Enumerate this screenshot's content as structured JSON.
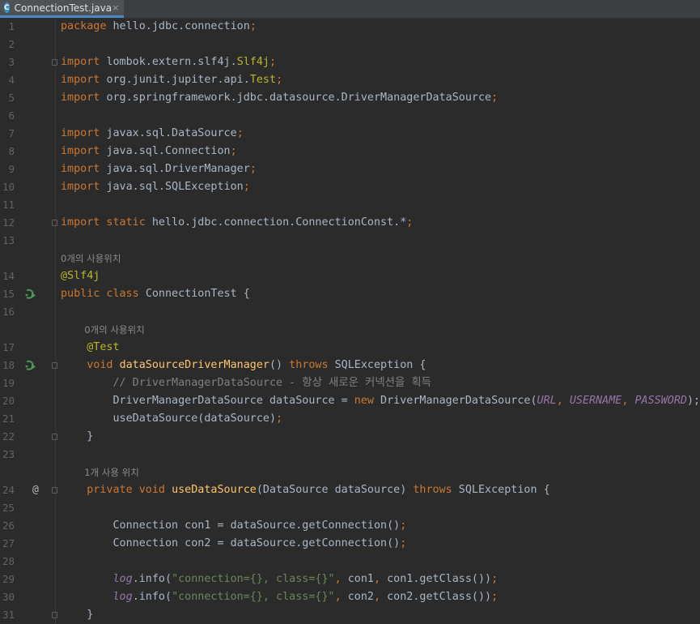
{
  "tab": {
    "filename": "ConnectionTest.java",
    "close": "×",
    "icon_letter": "C"
  },
  "gutter": {
    "run_icon": "run-test-icon",
    "implements_icon": "@"
  },
  "hints": {
    "class_usage": "0개의 사용위치",
    "test_usage": "0개의 사용위치",
    "method_usage": "1개 사용 위치"
  },
  "lines": [
    {
      "n": "1",
      "segs": [
        {
          "t": "package ",
          "c": "kw"
        },
        {
          "t": "hello.jdbc.connection"
        },
        {
          "t": ";",
          "c": "kw"
        }
      ]
    },
    {
      "n": "2",
      "segs": []
    },
    {
      "n": "3",
      "fold": true,
      "segs": [
        {
          "t": "import ",
          "c": "kw"
        },
        {
          "t": "lombok.extern.slf4j."
        },
        {
          "t": "Slf4j",
          "c": "ann"
        },
        {
          "t": ";",
          "c": "kw"
        }
      ]
    },
    {
      "n": "4",
      "segs": [
        {
          "t": "import ",
          "c": "kw"
        },
        {
          "t": "org.junit.jupiter.api."
        },
        {
          "t": "Test",
          "c": "ann"
        },
        {
          "t": ";",
          "c": "kw"
        }
      ]
    },
    {
      "n": "5",
      "segs": [
        {
          "t": "import ",
          "c": "kw"
        },
        {
          "t": "org.springframework.jdbc.datasource.DriverManagerDataSource"
        },
        {
          "t": ";",
          "c": "kw"
        }
      ]
    },
    {
      "n": "6",
      "segs": []
    },
    {
      "n": "7",
      "segs": [
        {
          "t": "import ",
          "c": "kw"
        },
        {
          "t": "javax.sql.DataSource"
        },
        {
          "t": ";",
          "c": "kw"
        }
      ]
    },
    {
      "n": "8",
      "segs": [
        {
          "t": "import ",
          "c": "kw"
        },
        {
          "t": "java.sql.Connection"
        },
        {
          "t": ";",
          "c": "kw"
        }
      ]
    },
    {
      "n": "9",
      "segs": [
        {
          "t": "import ",
          "c": "kw"
        },
        {
          "t": "java.sql.DriverManager"
        },
        {
          "t": ";",
          "c": "kw"
        }
      ]
    },
    {
      "n": "10",
      "segs": [
        {
          "t": "import ",
          "c": "kw"
        },
        {
          "t": "java.sql.SQLException"
        },
        {
          "t": ";",
          "c": "kw"
        }
      ]
    },
    {
      "n": "11",
      "segs": []
    },
    {
      "n": "12",
      "fold": true,
      "segs": [
        {
          "t": "import static ",
          "c": "kw"
        },
        {
          "t": "hello.jdbc.connection.ConnectionConst.*"
        },
        {
          "t": ";",
          "c": "kw"
        }
      ]
    },
    {
      "n": "13",
      "segs": []
    },
    {
      "hint": "class_usage",
      "indent": 0
    },
    {
      "n": "14",
      "segs": [
        {
          "t": "@Slf4j",
          "c": "ann"
        }
      ]
    },
    {
      "n": "15",
      "run": true,
      "segs": [
        {
          "t": "public class ",
          "c": "kw"
        },
        {
          "t": "ConnectionTest {"
        }
      ]
    },
    {
      "n": "16",
      "segs": []
    },
    {
      "hint": "test_usage",
      "indent": 4
    },
    {
      "n": "17",
      "segs": [
        {
          "t": "    "
        },
        {
          "t": "@Test",
          "c": "ann"
        }
      ]
    },
    {
      "n": "18",
      "run": true,
      "fold": true,
      "segs": [
        {
          "t": "    "
        },
        {
          "t": "void ",
          "c": "kw"
        },
        {
          "t": "dataSourceDriverManager",
          "c": "fn"
        },
        {
          "t": "() "
        },
        {
          "t": "throws ",
          "c": "kw"
        },
        {
          "t": "SQLException {"
        }
      ]
    },
    {
      "n": "19",
      "segs": [
        {
          "t": "        "
        },
        {
          "t": "// DriverManagerDataSource - 항상 새로운 커넥션을 획득",
          "c": "cmt"
        }
      ]
    },
    {
      "n": "20",
      "segs": [
        {
          "t": "        DriverManagerDataSource dataSource = "
        },
        {
          "t": "new ",
          "c": "kw"
        },
        {
          "t": "DriverManagerDataSource("
        },
        {
          "t": "URL",
          "c": "cst"
        },
        {
          "t": ", ",
          "c": "kw"
        },
        {
          "t": "USERNAME",
          "c": "cst"
        },
        {
          "t": ", ",
          "c": "kw"
        },
        {
          "t": "PASSWORD",
          "c": "cst"
        },
        {
          "t": ");"
        }
      ]
    },
    {
      "n": "21",
      "segs": [
        {
          "t": "        useDataSource(dataSource)"
        },
        {
          "t": ";",
          "c": "kw"
        }
      ]
    },
    {
      "n": "22",
      "fold": true,
      "segs": [
        {
          "t": "    }"
        }
      ]
    },
    {
      "n": "23",
      "segs": []
    },
    {
      "hint": "method_usage",
      "indent": 4
    },
    {
      "n": "24",
      "impl": true,
      "fold": true,
      "segs": [
        {
          "t": "    "
        },
        {
          "t": "private void ",
          "c": "kw"
        },
        {
          "t": "useDataSource",
          "c": "fn"
        },
        {
          "t": "(DataSource dataSource) "
        },
        {
          "t": "throws ",
          "c": "kw"
        },
        {
          "t": "SQLException {"
        }
      ]
    },
    {
      "n": "25",
      "segs": []
    },
    {
      "n": "26",
      "segs": [
        {
          "t": "        Connection con1 = dataSource.getConnection()"
        },
        {
          "t": ";",
          "c": "kw"
        }
      ]
    },
    {
      "n": "27",
      "segs": [
        {
          "t": "        Connection con2 = dataSource.getConnection()"
        },
        {
          "t": ";",
          "c": "kw"
        }
      ]
    },
    {
      "n": "28",
      "segs": []
    },
    {
      "n": "29",
      "segs": [
        {
          "t": "        "
        },
        {
          "t": "log",
          "c": "fld"
        },
        {
          "t": ".info("
        },
        {
          "t": "\"connection={}, class={}\"",
          "c": "str"
        },
        {
          "t": ", ",
          "c": "kw"
        },
        {
          "t": "con1"
        },
        {
          "t": ", ",
          "c": "kw"
        },
        {
          "t": "con1.getClass())"
        },
        {
          "t": ";",
          "c": "kw"
        }
      ]
    },
    {
      "n": "30",
      "segs": [
        {
          "t": "        "
        },
        {
          "t": "log",
          "c": "fld"
        },
        {
          "t": ".info("
        },
        {
          "t": "\"connection={}, class={}\"",
          "c": "str"
        },
        {
          "t": ", ",
          "c": "kw"
        },
        {
          "t": "con2"
        },
        {
          "t": ", ",
          "c": "kw"
        },
        {
          "t": "con2.getClass())"
        },
        {
          "t": ";",
          "c": "kw"
        }
      ]
    },
    {
      "n": "31",
      "fold": true,
      "segs": [
        {
          "t": "    }"
        }
      ]
    }
  ]
}
